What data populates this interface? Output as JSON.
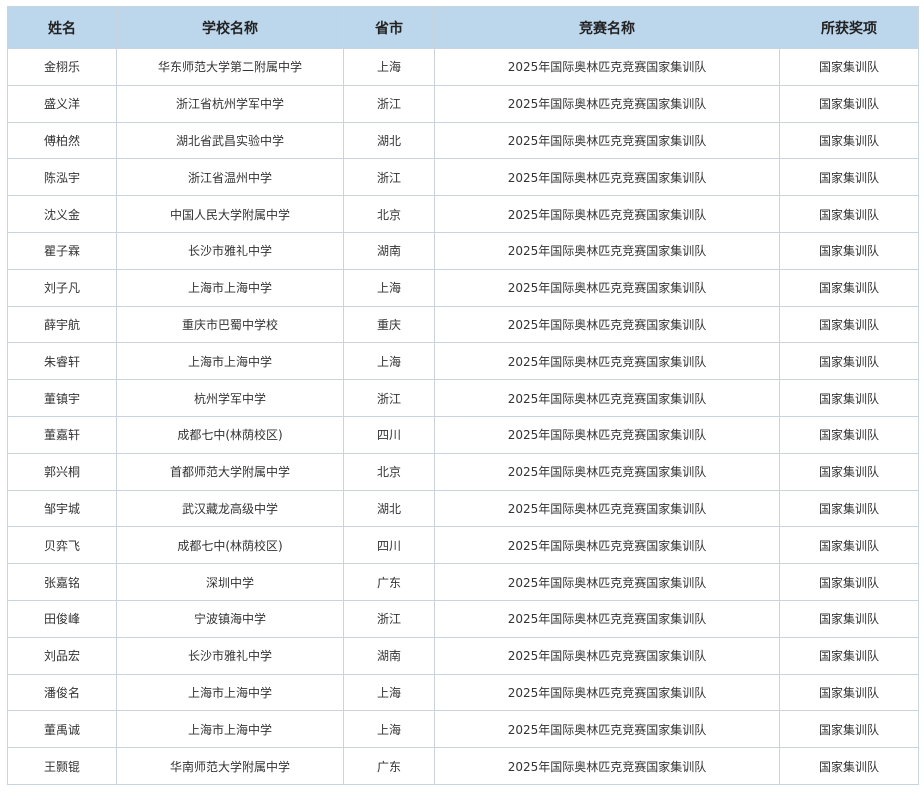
{
  "table": {
    "headers": [
      "姓名",
      "学校名称",
      "省市",
      "竞赛名称",
      "所获奖项"
    ],
    "rows": [
      [
        "金栩乐",
        "华东师范大学第二附属中学",
        "上海",
        "2025年国际奥林匹克竞赛国家集训队",
        "国家集训队"
      ],
      [
        "盛义洋",
        "浙江省杭州学军中学",
        "浙江",
        "2025年国际奥林匹克竞赛国家集训队",
        "国家集训队"
      ],
      [
        "傅柏然",
        "湖北省武昌实验中学",
        "湖北",
        "2025年国际奥林匹克竞赛国家集训队",
        "国家集训队"
      ],
      [
        "陈泓宇",
        "浙江省温州中学",
        "浙江",
        "2025年国际奥林匹克竞赛国家集训队",
        "国家集训队"
      ],
      [
        "沈义金",
        "中国人民大学附属中学",
        "北京",
        "2025年国际奥林匹克竞赛国家集训队",
        "国家集训队"
      ],
      [
        "瞿子霖",
        "长沙市雅礼中学",
        "湖南",
        "2025年国际奥林匹克竞赛国家集训队",
        "国家集训队"
      ],
      [
        "刘子凡",
        "上海市上海中学",
        "上海",
        "2025年国际奥林匹克竞赛国家集训队",
        "国家集训队"
      ],
      [
        "薛宇航",
        "重庆市巴蜀中学校",
        "重庆",
        "2025年国际奥林匹克竞赛国家集训队",
        "国家集训队"
      ],
      [
        "朱睿轩",
        "上海市上海中学",
        "上海",
        "2025年国际奥林匹克竞赛国家集训队",
        "国家集训队"
      ],
      [
        "董镇宇",
        "杭州学军中学",
        "浙江",
        "2025年国际奥林匹克竞赛国家集训队",
        "国家集训队"
      ],
      [
        "董嘉轩",
        "成都七中(林荫校区)",
        "四川",
        "2025年国际奥林匹克竞赛国家集训队",
        "国家集训队"
      ],
      [
        "郭兴桐",
        "首都师范大学附属中学",
        "北京",
        "2025年国际奥林匹克竞赛国家集训队",
        "国家集训队"
      ],
      [
        "邹宇城",
        "武汉藏龙高级中学",
        "湖北",
        "2025年国际奥林匹克竞赛国家集训队",
        "国家集训队"
      ],
      [
        "贝弈飞",
        "成都七中(林荫校区)",
        "四川",
        "2025年国际奥林匹克竞赛国家集训队",
        "国家集训队"
      ],
      [
        "张嘉铭",
        "深圳中学",
        "广东",
        "2025年国际奥林匹克竞赛国家集训队",
        "国家集训队"
      ],
      [
        "田俊峰",
        "宁波镇海中学",
        "浙江",
        "2025年国际奥林匹克竞赛国家集训队",
        "国家集训队"
      ],
      [
        "刘品宏",
        "长沙市雅礼中学",
        "湖南",
        "2025年国际奥林匹克竞赛国家集训队",
        "国家集训队"
      ],
      [
        "潘俊名",
        "上海市上海中学",
        "上海",
        "2025年国际奥林匹克竞赛国家集训队",
        "国家集训队"
      ],
      [
        "董禹诚",
        "上海市上海中学",
        "上海",
        "2025年国际奥林匹克竞赛国家集训队",
        "国家集训队"
      ],
      [
        "王颢锟",
        "华南师范大学附属中学",
        "广东",
        "2025年国际奥林匹克竞赛国家集训队",
        "国家集训队"
      ]
    ]
  },
  "colors": {
    "header_bg": "#bcd6ec",
    "border": "#c9d4df",
    "text": "#333333"
  }
}
